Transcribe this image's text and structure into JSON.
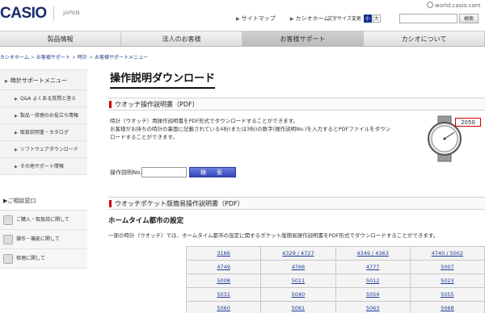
{
  "header": {
    "logo": "CASIO",
    "region": "JAPAN",
    "domain": "world.casio.com",
    "links": [
      "サイトマップ",
      "カシオホーム"
    ],
    "font_size_label": "文字サイズ変更",
    "font_size_options": [
      "小",
      "大"
    ],
    "search_button": "検索"
  },
  "gnav": [
    "製品情報",
    "法人のお客様",
    "お客様サポート",
    "カシオについて"
  ],
  "breadcrumb": [
    "カシオホーム",
    "お客様サポート",
    "時計",
    "お客様サポートメニュー"
  ],
  "sidebar": {
    "menu_title": "時計サポートメニュー",
    "items": [
      "Q&A よくある質問と答え",
      "製品・修理のお役立ち情報",
      "取扱説明書・カタログ",
      "ソフトウェアダウンロード",
      "その他サポート情報"
    ],
    "contact_title": "ご相談窓口",
    "contact_items": [
      "ご購入・取扱説に関して",
      "操作・機能に関して",
      "修理に関して"
    ]
  },
  "main": {
    "page_title": "操作説明ダウンロード",
    "section1_title": "ウオッチ操作説明書（PDF）",
    "section1_desc": [
      "時計（ウオッチ）用操作説明書をPDF形式でダウンロードすることができます。",
      "お客様がお持ちの時計の裏面に記載されている4桁(または3桁)の数字(操作説明No.)を入力するとPDFファイルをダウン",
      "ロードすることができます。"
    ],
    "watch_code": "2050",
    "model_label": "操作説明No.",
    "model_value": "",
    "search_button": "検　索",
    "section2_title": "ウオッチポケット版簡易操作説明書（PDF）",
    "subsection_title": "ホームタイム都市の設定",
    "section2_desc": "一部の時計（ウオッチ）では、ホームタイム都市の設定に関するポケット版簡易操作説明書をPDF形式でダウンロードすることができます。",
    "models": [
      [
        "3166",
        "4329 / 4727",
        "4349 / 4363",
        "4740 / 5002"
      ],
      [
        "4749",
        "4766",
        "4777",
        "5007"
      ],
      [
        "5008",
        "5011",
        "5012",
        "5023"
      ],
      [
        "5031",
        "5040",
        "5054",
        "5055"
      ],
      [
        "5060",
        "5061",
        "5063",
        "5068"
      ]
    ]
  }
}
